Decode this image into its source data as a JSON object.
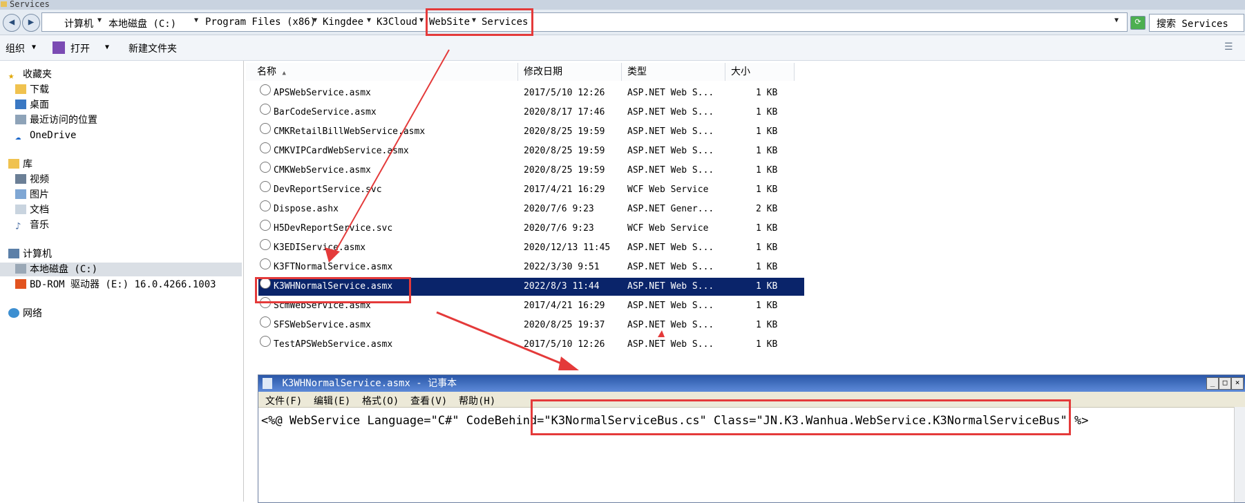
{
  "window": {
    "title": "Services"
  },
  "address": {
    "crumbs": [
      "计算机",
      "本地磁盘 (C:)",
      "Program Files (x86)",
      "Kingdee",
      "K3Cloud",
      "WebSite",
      "Services"
    ],
    "search_placeholder": "搜索 Services"
  },
  "toolbar": {
    "organize": "组织",
    "open": "打开",
    "new_folder": "新建文件夹"
  },
  "nav": {
    "favorites": "收藏夹",
    "downloads": "下载",
    "desktop": "桌面",
    "recent": "最近访问的位置",
    "onedrive": "OneDrive",
    "libraries": "库",
    "videos": "视频",
    "pictures": "图片",
    "documents": "文档",
    "music": "音乐",
    "computer": "计算机",
    "local_disk": "本地磁盘 (C:)",
    "bdrom": "BD-ROM 驱动器 (E:) 16.0.4266.1003",
    "network": "网络"
  },
  "columns": {
    "name": "名称",
    "date": "修改日期",
    "type": "类型",
    "size": "大小"
  },
  "files": [
    {
      "name": "APSWebService.asmx",
      "date": "2017/5/10 12:26",
      "type": "ASP.NET Web S...",
      "size": "1 KB"
    },
    {
      "name": "BarCodeService.asmx",
      "date": "2020/8/17 17:46",
      "type": "ASP.NET Web S...",
      "size": "1 KB"
    },
    {
      "name": "CMKRetailBillWebService.asmx",
      "date": "2020/8/25 19:59",
      "type": "ASP.NET Web S...",
      "size": "1 KB"
    },
    {
      "name": "CMKVIPCardWebService.asmx",
      "date": "2020/8/25 19:59",
      "type": "ASP.NET Web S...",
      "size": "1 KB"
    },
    {
      "name": "CMKWebService.asmx",
      "date": "2020/8/25 19:59",
      "type": "ASP.NET Web S...",
      "size": "1 KB"
    },
    {
      "name": "DevReportService.svc",
      "date": "2017/4/21 16:29",
      "type": "WCF Web Service",
      "size": "1 KB"
    },
    {
      "name": "Dispose.ashx",
      "date": "2020/7/6 9:23",
      "type": "ASP.NET Gener...",
      "size": "2 KB"
    },
    {
      "name": "H5DevReportService.svc",
      "date": "2020/7/6 9:23",
      "type": "WCF Web Service",
      "size": "1 KB"
    },
    {
      "name": "K3EDIService.asmx",
      "date": "2020/12/13 11:45",
      "type": "ASP.NET Web S...",
      "size": "1 KB"
    },
    {
      "name": "K3FTNormalService.asmx",
      "date": "2022/3/30 9:51",
      "type": "ASP.NET Web S...",
      "size": "1 KB"
    },
    {
      "name": "K3WHNormalService.asmx",
      "date": "2022/8/3 11:44",
      "type": "ASP.NET Web S...",
      "size": "1 KB",
      "selected": true
    },
    {
      "name": "ScmWebService.asmx",
      "date": "2017/4/21 16:29",
      "type": "ASP.NET Web S...",
      "size": "1 KB"
    },
    {
      "name": "SFSWebService.asmx",
      "date": "2020/8/25 19:37",
      "type": "ASP.NET Web S...",
      "size": "1 KB"
    },
    {
      "name": "TestAPSWebService.asmx",
      "date": "2017/5/10 12:26",
      "type": "ASP.NET Web S...",
      "size": "1 KB"
    }
  ],
  "notepad": {
    "title": "K3WHNormalService.asmx - 记事本",
    "menu": [
      "文件(F)",
      "编辑(E)",
      "格式(O)",
      "查看(V)",
      "帮助(H)"
    ],
    "content": "<%@ WebService Language=\"C#\" CodeBehind=\"K3NormalServiceBus.cs\" Class=\"JN.K3.Wanhua.WebService.K3NormalServiceBus\" %>"
  },
  "colors": {
    "selection": "#0a246a",
    "annotation": "#e43a3a",
    "titlebar": "#2a57a8"
  }
}
